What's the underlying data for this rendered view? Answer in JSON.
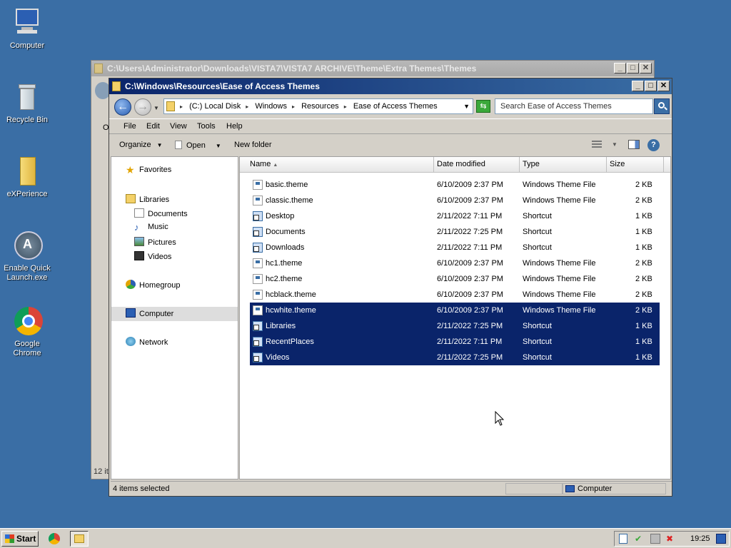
{
  "desktop": {
    "icons": [
      {
        "label": "Computer",
        "icon": "computer-icon"
      },
      {
        "label": "Recycle Bin",
        "icon": "recycle-bin-icon"
      },
      {
        "label": "eXPerience",
        "icon": "folder-icon"
      },
      {
        "label": "Enable Quick Launch.exe",
        "icon": "quick-launch-icon"
      },
      {
        "label": "Google Chrome",
        "icon": "chrome-icon"
      }
    ]
  },
  "bg_window": {
    "title": "C:\\Users\\Administrator\\Downloads\\VISTA7\\VISTA7 ARCHIVE\\Theme\\Extra Themes\\Themes",
    "status": "12 it",
    "side_letter": "O"
  },
  "window": {
    "title": "C:\\Windows\\Resources\\Ease of Access Themes",
    "breadcrumbs": [
      "(C:) Local Disk",
      "Windows",
      "Resources",
      "Ease of Access Themes"
    ],
    "search_placeholder": "Search Ease of Access Themes",
    "menu": [
      "File",
      "Edit",
      "View",
      "Tools",
      "Help"
    ],
    "toolbar": {
      "organize": "Organize",
      "open": "Open",
      "new_folder": "New folder"
    },
    "nav": {
      "favorites": "Favorites",
      "libraries": "Libraries",
      "documents": "Documents",
      "music": "Music",
      "pictures": "Pictures",
      "videos": "Videos",
      "homegroup": "Homegroup",
      "computer": "Computer",
      "network": "Network"
    },
    "columns": {
      "name": "Name",
      "date": "Date modified",
      "type": "Type",
      "size": "Size"
    },
    "files": [
      {
        "name": "basic.theme",
        "date": "6/10/2009 2:37 PM",
        "type": "Windows Theme File",
        "size": "2 KB",
        "kind": "theme",
        "selected": false
      },
      {
        "name": "classic.theme",
        "date": "6/10/2009 2:37 PM",
        "type": "Windows Theme File",
        "size": "2 KB",
        "kind": "theme",
        "selected": false
      },
      {
        "name": "Desktop",
        "date": "2/11/2022 7:11 PM",
        "type": "Shortcut",
        "size": "1 KB",
        "kind": "shortcut",
        "selected": false
      },
      {
        "name": "Documents",
        "date": "2/11/2022 7:25 PM",
        "type": "Shortcut",
        "size": "1 KB",
        "kind": "shortcut",
        "selected": false
      },
      {
        "name": "Downloads",
        "date": "2/11/2022 7:11 PM",
        "type": "Shortcut",
        "size": "1 KB",
        "kind": "shortcut",
        "selected": false
      },
      {
        "name": "hc1.theme",
        "date": "6/10/2009 2:37 PM",
        "type": "Windows Theme File",
        "size": "2 KB",
        "kind": "theme",
        "selected": false
      },
      {
        "name": "hc2.theme",
        "date": "6/10/2009 2:37 PM",
        "type": "Windows Theme File",
        "size": "2 KB",
        "kind": "theme",
        "selected": false
      },
      {
        "name": "hcblack.theme",
        "date": "6/10/2009 2:37 PM",
        "type": "Windows Theme File",
        "size": "2 KB",
        "kind": "theme",
        "selected": false
      },
      {
        "name": "hcwhite.theme",
        "date": "6/10/2009 2:37 PM",
        "type": "Windows Theme File",
        "size": "2 KB",
        "kind": "theme",
        "selected": true
      },
      {
        "name": "Libraries",
        "date": "2/11/2022 7:25 PM",
        "type": "Shortcut",
        "size": "1 KB",
        "kind": "shortcut",
        "selected": true
      },
      {
        "name": "RecentPlaces",
        "date": "2/11/2022 7:11 PM",
        "type": "Shortcut",
        "size": "1 KB",
        "kind": "shortcut",
        "selected": true
      },
      {
        "name": "Videos",
        "date": "2/11/2022 7:25 PM",
        "type": "Shortcut",
        "size": "1 KB",
        "kind": "shortcut",
        "selected": true
      }
    ],
    "status_left": "4 items selected",
    "status_right": "Computer"
  },
  "taskbar": {
    "start": "Start",
    "clock": "19:25"
  },
  "colors": {
    "desktop": "#3a6ea5",
    "selection": "#0a246a",
    "title_active": "#0a246a"
  }
}
